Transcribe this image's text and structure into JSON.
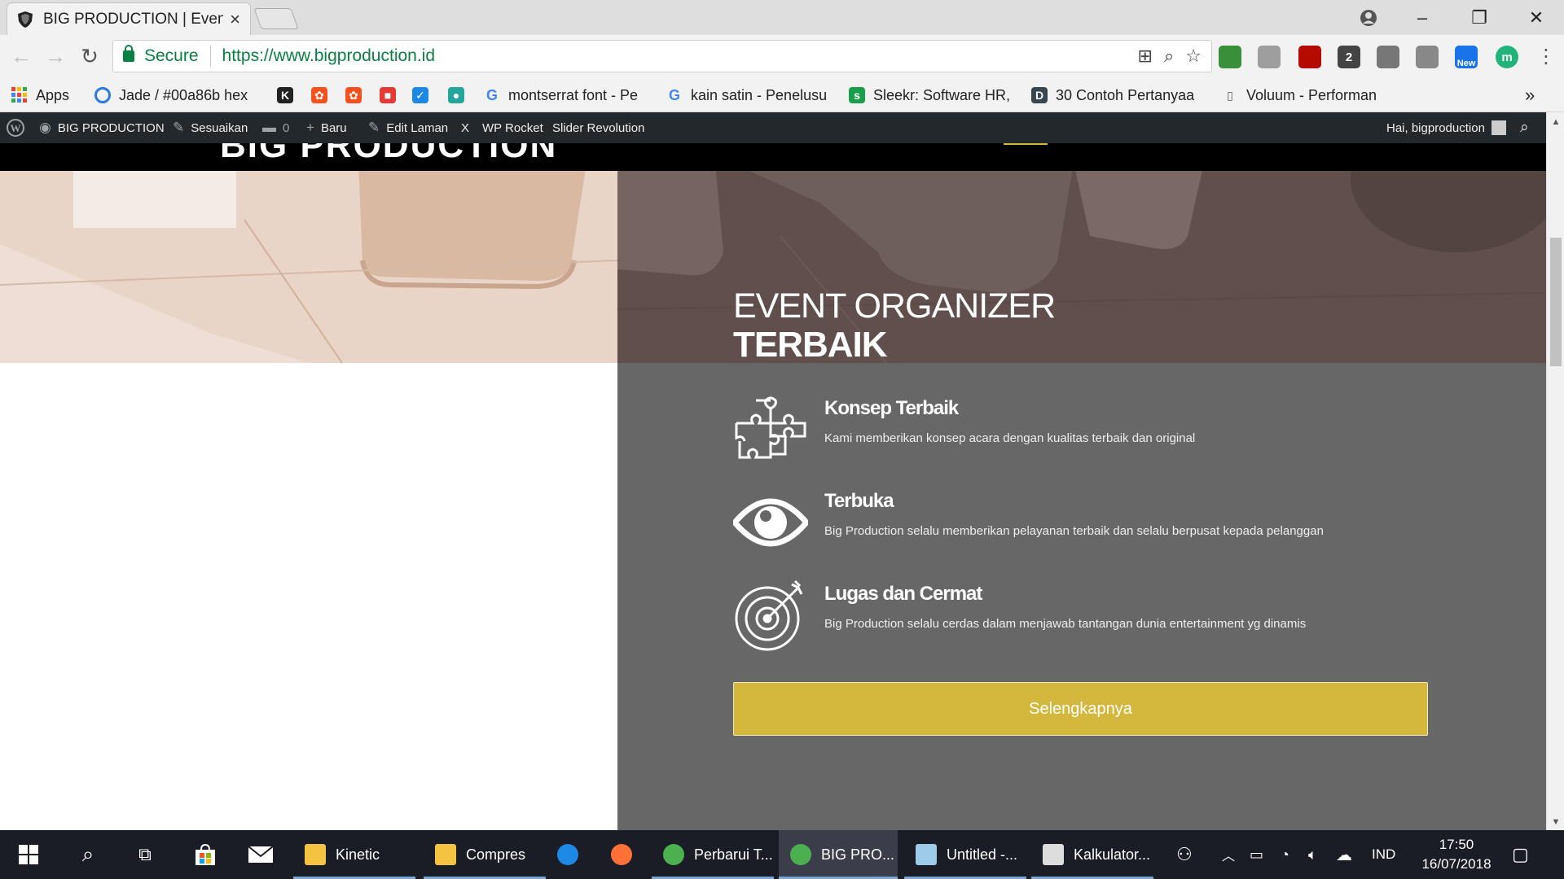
{
  "browser": {
    "tab": {
      "title": "BIG PRODUCTION | Event"
    },
    "window_controls": {
      "minimize": "–",
      "maximize": "❐",
      "close": "✕"
    },
    "omnibox": {
      "secure_label": "Secure",
      "url": "https://www.bigproduction.id"
    },
    "extensions": [
      {
        "name": "extension-globe",
        "color": "#3a8f3a"
      },
      {
        "name": "extension-drive",
        "color": "#9e9e9e"
      },
      {
        "name": "extension-acrobat",
        "color": "#b30b00"
      },
      {
        "name": "extension-counter",
        "color": "#444444",
        "label": "2"
      },
      {
        "name": "extension-gears",
        "color": "#777777"
      },
      {
        "name": "extension-camera",
        "color": "#888888"
      },
      {
        "name": "extension-new",
        "color": "#1a73e8",
        "label": "New"
      },
      {
        "name": "extension-profile",
        "color": "#21b37a",
        "label": "m"
      }
    ]
  },
  "bookmarks": [
    {
      "label": "Apps",
      "color": "#e8453c"
    },
    {
      "label": "Jade / #00a86b hex",
      "color": "#2a7ae2"
    },
    {
      "label": "",
      "color": "#222222",
      "glyph": "K"
    },
    {
      "label": "",
      "color": "#f4511e",
      "glyph": "✿"
    },
    {
      "label": "",
      "color": "#f4511e",
      "glyph": "✿"
    },
    {
      "label": "",
      "color": "#e53935",
      "glyph": "■"
    },
    {
      "label": "",
      "color": "#1e88e5",
      "glyph": "✓"
    },
    {
      "label": "",
      "color": "#26a69a",
      "glyph": "●"
    },
    {
      "label": "montserrat font - Pe",
      "color": "#4285f4",
      "glyph": "G"
    },
    {
      "label": "kain satin - Penelusu",
      "color": "#4285f4",
      "glyph": "G"
    },
    {
      "label": "Sleekr: Software HR,",
      "color": "#1b9e4b",
      "glyph": "s"
    },
    {
      "label": "30 Contoh Pertanyaa",
      "color": "#37474f",
      "glyph": "D"
    },
    {
      "label": "Voluum - Performan",
      "color": "#ffffff",
      "glyph": "▯"
    }
  ],
  "bookmarks_overflow": "»",
  "wp_admin_bar": {
    "site_name": "BIG PRODUCTION",
    "customize": "Sesuaikan",
    "comments_count": "0",
    "new": "Baru",
    "edit_page": "Edit Laman",
    "x_label": "X",
    "wp_rocket": "WP Rocket",
    "slider_revolution": "Slider Revolution",
    "greeting": "Hai, bigproduction"
  },
  "site": {
    "logo_text": "BIG PRODUCTION",
    "heading": {
      "line1": "EVENT ORGANIZER",
      "line2": "TERBAIK"
    },
    "features": [
      {
        "icon": "puzzle-icon",
        "title": "Konsep Terbaik",
        "description": "Kami memberikan konsep acara dengan kualitas terbaik dan original"
      },
      {
        "icon": "eye-icon",
        "title": "Terbuka",
        "description": "Big Production selalu memberikan pelayanan terbaik dan selalu berpusat kepada pelanggan"
      },
      {
        "icon": "target-icon",
        "title": "Lugas dan Cermat",
        "description": "Big Production selalu cerdas dalam menjawab tantangan dunia entertainment yg dinamis"
      }
    ],
    "cta_label": "Selengkapnya",
    "colors": {
      "accent": "#d3b83d",
      "panel": "#676767",
      "header": "#000000"
    }
  },
  "taskbar": {
    "apps": [
      {
        "label": "Kinetic",
        "color": "#f5c342"
      },
      {
        "label": "Compres",
        "color": "#f5c342"
      },
      {
        "label": "",
        "color": "#1e88e5"
      },
      {
        "label": "",
        "color": "#ff7139"
      },
      {
        "label": "Perbarui T...",
        "color": "#4caf50"
      },
      {
        "label": "BIG PRO...",
        "color": "#4caf50"
      },
      {
        "label": "Untitled -...",
        "color": "#9ecbe8"
      },
      {
        "label": "Kalkulator...",
        "color": "#dddddd"
      }
    ],
    "language": "IND",
    "time": "17:50",
    "date": "16/07/2018"
  }
}
